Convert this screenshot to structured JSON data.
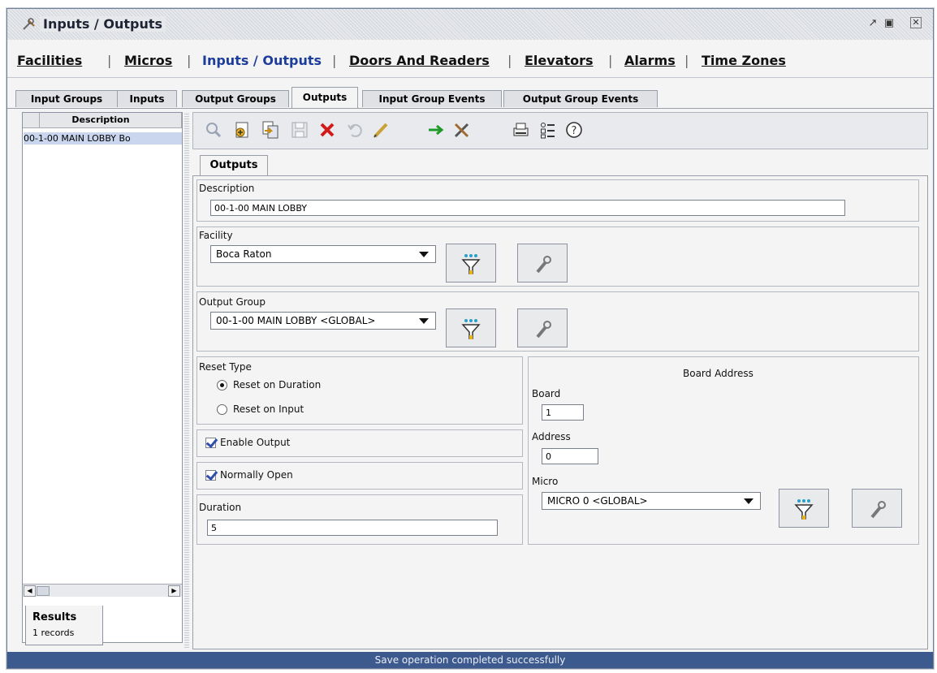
{
  "window": {
    "title": "Inputs / Outputs",
    "icon": "tools-icon"
  },
  "nav": {
    "items": [
      {
        "label": "Facilities",
        "active": false
      },
      {
        "label": "Micros",
        "active": false
      },
      {
        "label": "Inputs / Outputs",
        "active": true
      },
      {
        "label": "Doors And Readers",
        "active": false
      },
      {
        "label": "Elevators",
        "active": false
      },
      {
        "label": "Alarms",
        "active": false
      },
      {
        "label": "Time Zones",
        "active": false
      }
    ],
    "separator": "|"
  },
  "tabs": [
    {
      "label": "Input Groups",
      "active": false
    },
    {
      "label": "Inputs",
      "active": false
    },
    {
      "label": "Output Groups",
      "active": false
    },
    {
      "label": "Outputs",
      "active": true
    },
    {
      "label": "Input Group Events",
      "active": false
    },
    {
      "label": "Output Group Events",
      "active": false
    }
  ],
  "results": {
    "column_header": "Description",
    "rows": [
      "00-1-00 MAIN LOBBY Bo"
    ],
    "tab_label": "Results",
    "count": "1 records"
  },
  "toolbar": {
    "icons": [
      "search-icon",
      "add-icon",
      "copy-icon",
      "save-icon",
      "delete-icon",
      "undo-icon",
      "edit-icon",
      "forward-icon",
      "tools-icon",
      "print-icon",
      "list-icon",
      "help-icon"
    ]
  },
  "form": {
    "subtab": "Outputs",
    "description": {
      "label": "Description",
      "value": "00-1-00 MAIN LOBBY"
    },
    "facility": {
      "label": "Facility",
      "value": "Boca Raton"
    },
    "output_group": {
      "label": "Output Group",
      "value": "00-1-00 MAIN LOBBY <GLOBAL>"
    },
    "reset_type": {
      "label": "Reset Type",
      "options": [
        {
          "label": "Reset on Duration",
          "selected": true
        },
        {
          "label": "Reset on Input",
          "selected": false
        }
      ]
    },
    "enable_output": {
      "label": "Enable Output",
      "checked": true
    },
    "normally_open": {
      "label": "Normally Open",
      "checked": true
    },
    "duration": {
      "label": "Duration",
      "value": "5"
    },
    "board_address": {
      "title": "Board Address",
      "board_label": "Board",
      "board_value": "1",
      "address_label": "Address",
      "address_value": "0",
      "micro_label": "Micro",
      "micro_value": "MICRO 0 <GLOBAL>"
    }
  },
  "status_message": "Save operation completed successfully",
  "colors": {
    "status_bar": "#3d5a8e",
    "active_nav": "#1d3d9c",
    "selected_row": "#c9d6ee"
  }
}
